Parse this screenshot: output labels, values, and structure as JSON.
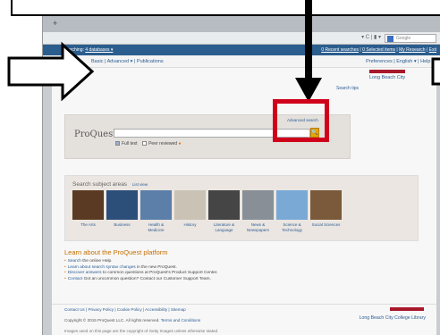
{
  "browser": {
    "new_tab": "+",
    "toolbar_tools": "▾ C | ▮ ▾",
    "search_placeholder": "Google"
  },
  "proquest": {
    "topbar": {
      "searching_label": "Searching:",
      "databases_link": "4 databases ▾",
      "recent_searches": "0 Recent searches",
      "selected_items": "0 Selected items",
      "my_research": "My Research",
      "exit": "Exit"
    },
    "nav": {
      "basic": "Basic",
      "advanced": "Advanced ▾",
      "publications": "Publications",
      "preferences": "Preferences",
      "language": "English ▾",
      "help": "Help"
    },
    "search": {
      "logo": "ProQuest",
      "advanced_search": "Advanced search",
      "full_text": "Full text",
      "peer_reviewed": "Peer reviewed",
      "search_tips": "Search tips",
      "search_button": "🔍"
    },
    "library_top": "Long Beach City",
    "subjects": {
      "title": "Search subject areas",
      "list_view": "List view",
      "items": [
        {
          "label": "The Arts",
          "color": "#5a3a22"
        },
        {
          "label": "Business",
          "color": "#2c4f7a"
        },
        {
          "label": "Health & Medicine",
          "color": "#5b7fa8"
        },
        {
          "label": "History",
          "color": "#c9c2b5"
        },
        {
          "label": "Literature & Language",
          "color": "#454545"
        },
        {
          "label": "News & Newspapers",
          "color": "#888f97"
        },
        {
          "label": "Science & Technology",
          "color": "#7aa9d6"
        },
        {
          "label": "Social Sciences",
          "color": "#7a5a3a"
        }
      ]
    },
    "learn": {
      "heading": "Learn about the ProQuest platform",
      "items": [
        {
          "link": "Search",
          "text": " the online Help."
        },
        {
          "link": "Learn about search syntax changes",
          "text": " in the new ProQuest."
        },
        {
          "link": "Discover answers",
          "text": " to common questions at ProQuest's Product Support Center."
        },
        {
          "link": "Contact",
          "text": " Got an uncommon question? Contact our Customer Support Team."
        }
      ]
    },
    "footer": {
      "links": "Contact Us | Privacy Policy | Cookie Policy | Accessibility | Sitemap",
      "copyright": "Copyright © 2015 ProQuest LLC. All rights reserved.",
      "terms": "Terms and Conditions",
      "images_note": "Images used on this page are the copyright of Getty Images unless otherwise stated.",
      "library": "Long Beach City College Library"
    }
  },
  "colors": {
    "topbar": "#2b5d8e",
    "highlight": "#d0021b",
    "accent": "#e07a00"
  }
}
